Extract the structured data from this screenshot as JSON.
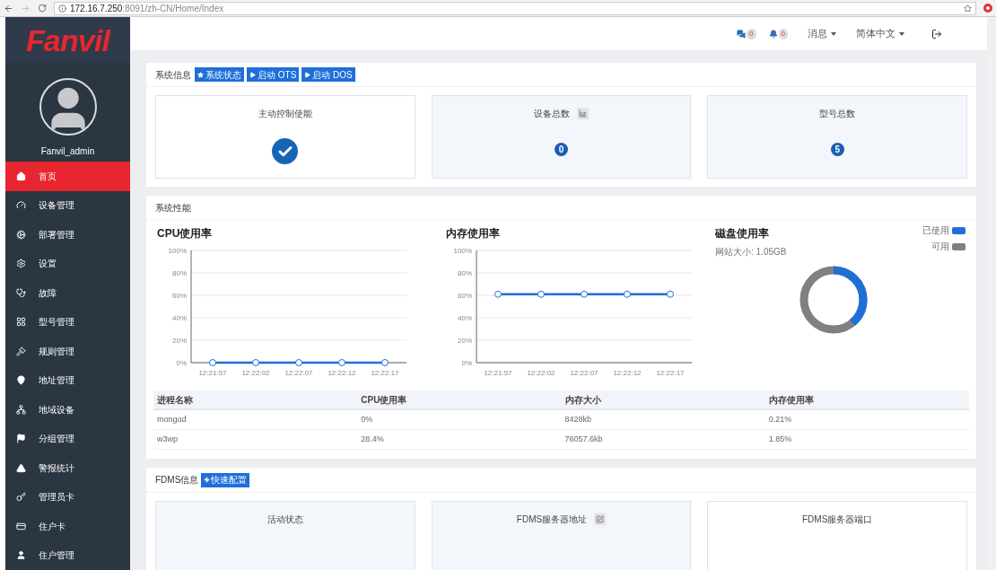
{
  "browser": {
    "url_host": "172.16.7.250",
    "url_rest": ":8091/zh-CN/Home/Index"
  },
  "sidebar": {
    "logo": "Fanvil",
    "username": "Fanvil_admin",
    "items": [
      {
        "label": "首页",
        "selected": true
      },
      {
        "label": "设备管理",
        "selected": false
      },
      {
        "label": "部署管理",
        "selected": false
      },
      {
        "label": "设置",
        "selected": false
      },
      {
        "label": "故障",
        "selected": false
      },
      {
        "label": "型号管理",
        "selected": false
      },
      {
        "label": "规则管理",
        "selected": false
      },
      {
        "label": "地址管理",
        "selected": false
      },
      {
        "label": "地域设备",
        "selected": false
      },
      {
        "label": "分组管理",
        "selected": false
      },
      {
        "label": "警报统计",
        "selected": false
      },
      {
        "label": "管理员卡",
        "selected": false
      },
      {
        "label": "住户卡",
        "selected": false
      },
      {
        "label": "住户管理",
        "selected": false
      }
    ]
  },
  "header": {
    "messages_count": "0",
    "alerts_count": "0",
    "messages_menu": "消息",
    "language_menu": "简体中文"
  },
  "system_info": {
    "title": "系统信息",
    "buttons": [
      {
        "label": "系统状态",
        "kind": "star"
      },
      {
        "label": "启动 OTS",
        "kind": "play"
      },
      {
        "label": "启动 DOS",
        "kind": "play"
      }
    ],
    "cards": [
      {
        "title": "主动控制使能",
        "kind": "check",
        "checked": true,
        "shaded": false
      },
      {
        "title": "设备总数",
        "kind": "count_chart",
        "value": "0",
        "shaded": true
      },
      {
        "title": "型号总数",
        "kind": "count",
        "value": "5",
        "shaded": true
      }
    ]
  },
  "performance": {
    "title": "系统性能",
    "cpu": {
      "heading": "CPU使用率",
      "chart_data": {
        "type": "line",
        "categories": [
          "12:21:57",
          "12:22:02",
          "12:22:07",
          "12:22:12",
          "12:22:17"
        ],
        "grid": true,
        "series": [
          {
            "color": "#1f6fd6",
            "marker": "circle",
            "values": [
              0,
              0,
              0,
              0,
              0
            ]
          }
        ],
        "ylim": [
          0,
          100
        ],
        "yticks": [
          {
            "value": 0,
            "label": "0%"
          },
          {
            "value": 20,
            "label": "20%"
          },
          {
            "value": 40,
            "label": "40%"
          },
          {
            "value": 60,
            "label": "60%"
          },
          {
            "value": 80,
            "label": "80%"
          },
          {
            "value": 100,
            "label": "100%"
          }
        ]
      }
    },
    "memory": {
      "heading": "内存使用率",
      "chart_data": {
        "type": "line",
        "categories": [
          "12:21:57",
          "12:22:02",
          "12:22:07",
          "12:22:12",
          "12:22:17"
        ],
        "grid": true,
        "series": [
          {
            "color": "#1f6fd6",
            "marker": "circle",
            "values": [
              61,
              61,
              61,
              61,
              61
            ]
          }
        ],
        "ylim": [
          0,
          100
        ],
        "yticks": [
          {
            "value": 0,
            "label": "0%"
          },
          {
            "value": 20,
            "label": "20%"
          },
          {
            "value": 40,
            "label": "40%"
          },
          {
            "value": 60,
            "label": "60%"
          },
          {
            "value": 80,
            "label": "80%"
          },
          {
            "value": 100,
            "label": "100%"
          }
        ]
      }
    },
    "disk": {
      "heading": "磁盘使用率",
      "site_size": "网站大小: 1.05GB",
      "legend": [
        {
          "label": "已使用",
          "color": "#1f6fd6"
        },
        {
          "label": "可用",
          "color": "#808080"
        }
      ]
    },
    "table": {
      "columns": [
        "进程名称",
        "CPU使用率",
        "内存大小",
        "内存使用率"
      ],
      "rows": [
        [
          "mongod",
          "0%",
          "8428kb",
          "0.21%"
        ],
        [
          "w3wp",
          "28.4%",
          "76057.6kb",
          "1.85%"
        ]
      ]
    }
  },
  "fdms": {
    "title": "FDMS信息",
    "button": "快速配置",
    "cards": [
      {
        "title": "活动状态",
        "kind": "plain",
        "shaded": true
      },
      {
        "title": "FDMS服务器地址",
        "kind": "edit",
        "shaded": true
      },
      {
        "title": "FDMS服务器端口",
        "kind": "plain",
        "shaded": false
      }
    ]
  }
}
